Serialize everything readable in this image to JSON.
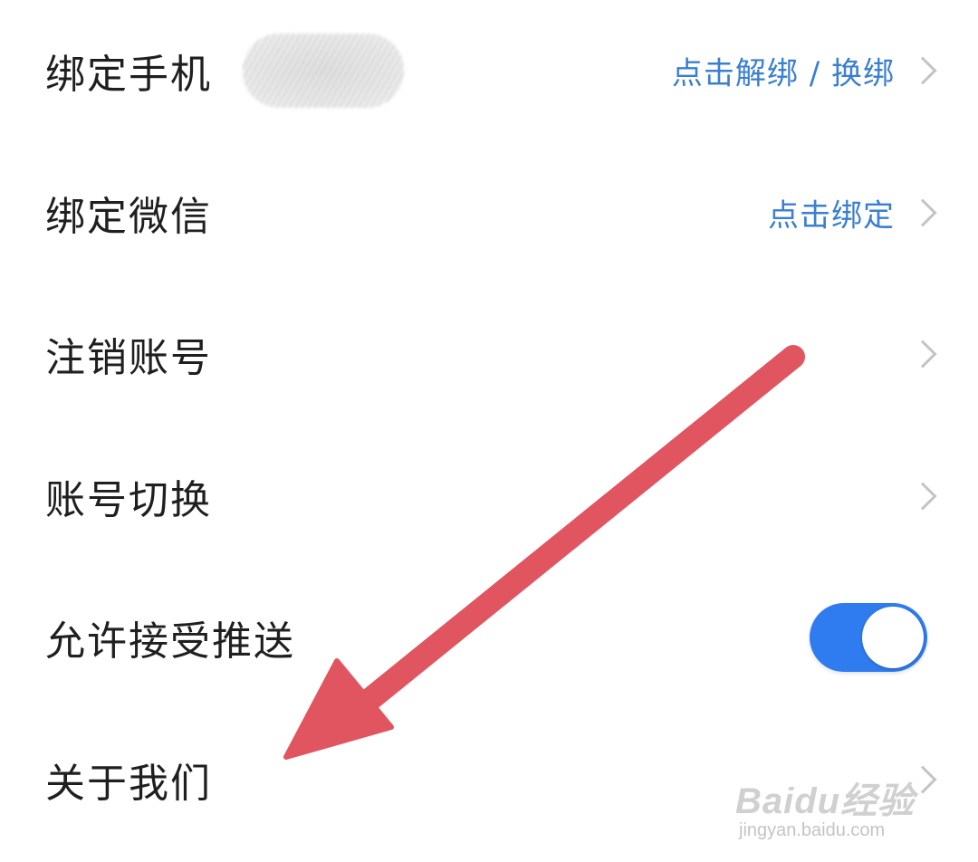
{
  "settings": {
    "bind_phone": {
      "label": "绑定手机",
      "action": "点击解绑 / 换绑"
    },
    "bind_wechat": {
      "label": "绑定微信",
      "action": "点击绑定"
    },
    "cancel_account": {
      "label": "注销账号"
    },
    "switch_account": {
      "label": "账号切换"
    },
    "allow_push": {
      "label": "允许接受推送",
      "enabled": true
    },
    "about_us": {
      "label": "关于我们"
    }
  },
  "watermark": {
    "logo": "Baidu经验",
    "url": "jingyan.baidu.com"
  },
  "colors": {
    "accent": "#2f7cf0",
    "link": "#3a7fd0",
    "annotation_arrow": "#e0555f"
  },
  "icons": {
    "chevron": "chevron-right-icon",
    "annotation": "arrow-annotation-icon"
  }
}
